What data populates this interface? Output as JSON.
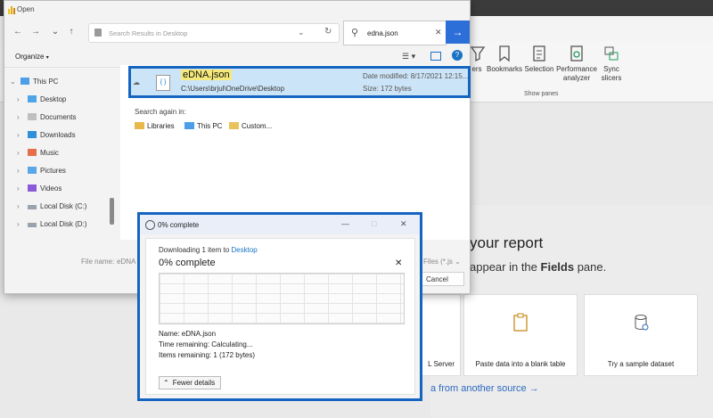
{
  "background": {
    "ribbon": {
      "buttons": [
        {
          "label": "ers",
          "icon": "funnel-icon"
        },
        {
          "label": "Bookmarks",
          "icon": "bookmark-icon"
        },
        {
          "label": "Selection",
          "icon": "selection-icon"
        },
        {
          "label": "Performance analyzer",
          "icon": "performance-icon"
        },
        {
          "label": "Sync slicers",
          "icon": "sync-icon"
        }
      ],
      "group_label": "Show panes"
    },
    "canvas": {
      "title": "your report",
      "subtitle_pre": "appear in the ",
      "subtitle_bold": "Fields",
      "subtitle_post": " pane.",
      "cards": [
        {
          "label": "L Server"
        },
        {
          "label": "Paste data into a blank table"
        },
        {
          "label": "Try a sample dataset"
        }
      ],
      "link": "a from another source →"
    }
  },
  "open_dialog": {
    "title": "Open",
    "address": "Search Results in Desktop",
    "search_value": "edna.json",
    "organize": "Organize",
    "nav": [
      {
        "label": "This PC",
        "icon": "pc-icon"
      },
      {
        "label": "Desktop",
        "icon": "folder-icon"
      },
      {
        "label": "Documents",
        "icon": "folder-icon"
      },
      {
        "label": "Downloads",
        "icon": "download-icon"
      },
      {
        "label": "Music",
        "icon": "music-icon"
      },
      {
        "label": "Pictures",
        "icon": "pictures-icon"
      },
      {
        "label": "Videos",
        "icon": "video-icon"
      },
      {
        "label": "Local Disk (C:)",
        "icon": "disk-icon"
      },
      {
        "label": "Local Disk (D:)",
        "icon": "disk-icon"
      }
    ],
    "result": {
      "name": "eDNA.json",
      "path": "C:\\Users\\brjul\\OneDrive\\Desktop",
      "date_modified": "Date modified: 8/17/2021 12:15...",
      "size": "Size: 172 bytes"
    },
    "search_again": "Search again in:",
    "search_again_links": [
      "Libraries",
      "This PC",
      "Custom..."
    ],
    "file_name_label": "File name:",
    "file_name_value": "eDNA",
    "file_type": "Files (*.js",
    "cancel": "Cancel"
  },
  "progress_dialog": {
    "title": "0% complete",
    "downloading_prefix": "Downloading 1 item to ",
    "destination": "Desktop",
    "percent_label": "0% complete",
    "progress_fraction": 0,
    "name_line": "Name: eDNA.json",
    "time_line": "Time remaining: Calculating...",
    "items_line": "Items remaining: 1 (172 bytes)",
    "fewer_details": "Fewer details"
  }
}
